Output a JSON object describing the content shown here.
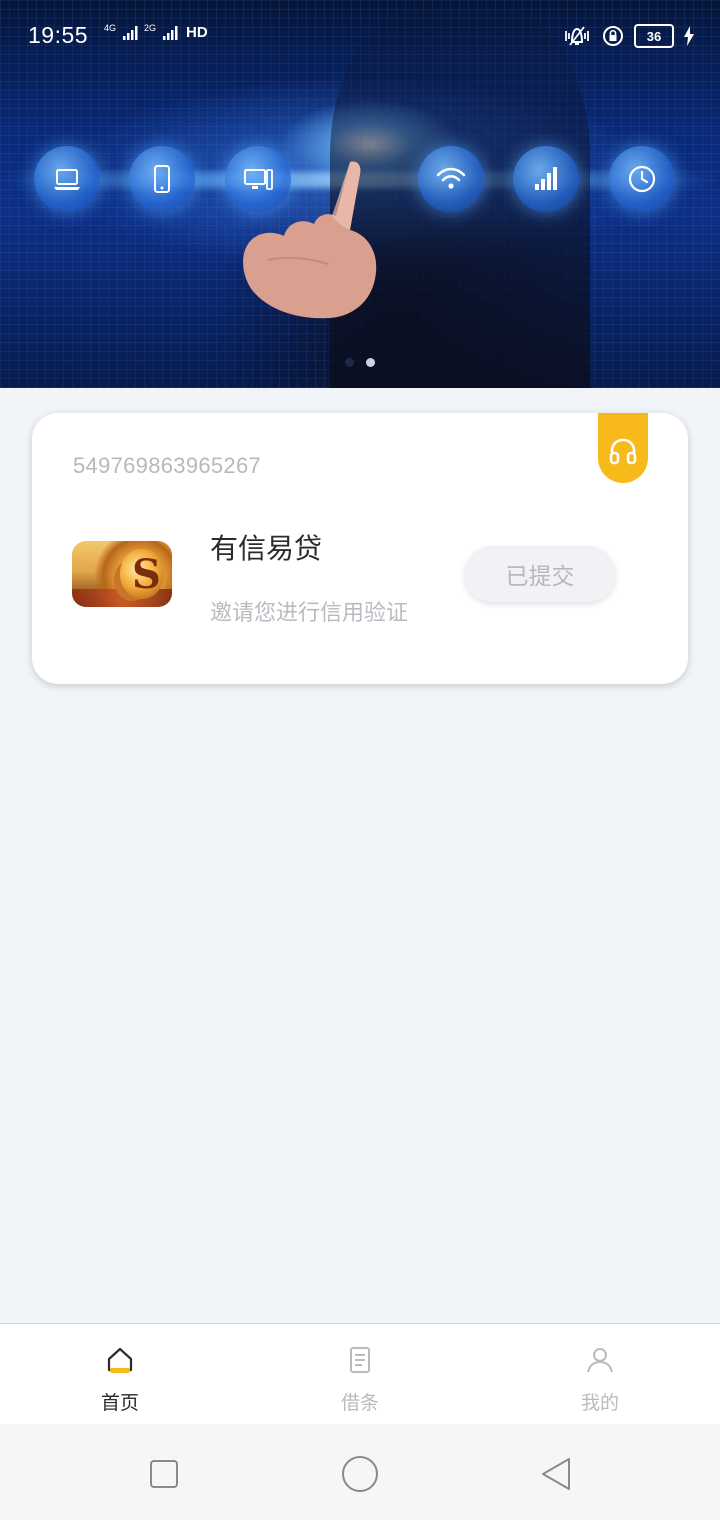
{
  "status_bar": {
    "time": "19:55",
    "network_1": "4G",
    "network_2": "2G",
    "hd_label": "HD",
    "battery_level": "36"
  },
  "banner": {
    "page_count": 2,
    "active_page": 2,
    "icons": [
      "laptop-icon",
      "phone-icon",
      "desktop-icon",
      "wifi-icon",
      "signal-icon",
      "clock-icon"
    ]
  },
  "card": {
    "id": "549769863965267",
    "loan_name": "有信易贷",
    "loan_desc": "邀请您进行信用验证",
    "status_button": "已提交",
    "support_icon": "headset-icon",
    "accent_color": "#f8b91b"
  },
  "tabbar": {
    "tabs": [
      {
        "label": "首页",
        "icon": "home-icon",
        "active": true
      },
      {
        "label": "借条",
        "icon": "document-icon",
        "active": false
      },
      {
        "label": "我的",
        "icon": "user-icon",
        "active": false
      }
    ]
  },
  "navbar": {
    "buttons": [
      "recent-apps-icon",
      "home-circle-icon",
      "back-triangle-icon"
    ]
  }
}
